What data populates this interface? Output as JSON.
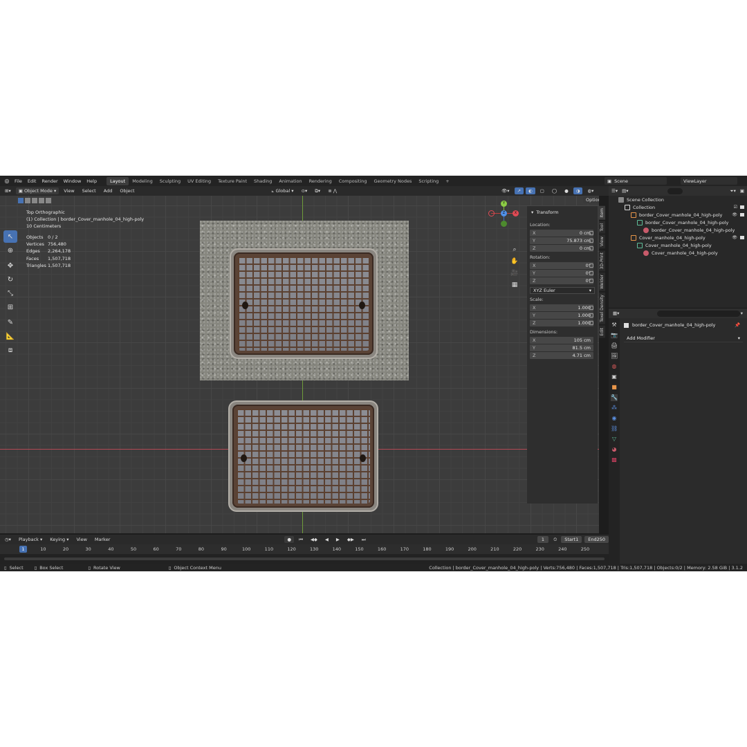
{
  "menu": [
    "File",
    "Edit",
    "Render",
    "Window",
    "Help"
  ],
  "workspaces": [
    "Layout",
    "Modeling",
    "Sculpting",
    "UV Editing",
    "Texture Paint",
    "Shading",
    "Animation",
    "Rendering",
    "Compositing",
    "Geometry Nodes",
    "Scripting",
    "+"
  ],
  "active_workspace": "Layout",
  "scene": "Scene",
  "view_layer": "ViewLayer",
  "header": {
    "mode": "Object Mode",
    "view": "View",
    "select": "Select",
    "add": "Add",
    "object": "Object",
    "orientation": "Global",
    "options": "Options"
  },
  "overlay": {
    "view_name": "Top Orthographic",
    "collection": "(1) Collection | border_Cover_manhole_04_high-poly",
    "scale": "10 Centimeters"
  },
  "stats": [
    {
      "k": "Objects",
      "v": "0 / 2"
    },
    {
      "k": "Vertices",
      "v": "756,480"
    },
    {
      "k": "Edges",
      "v": "2,264,178"
    },
    {
      "k": "Faces",
      "v": "1,507,718"
    },
    {
      "k": "Triangles",
      "v": "1,507,718"
    }
  ],
  "gizmo": {
    "y": "Y",
    "x": "X",
    "z": "Z"
  },
  "transform": {
    "title": "Transform",
    "location_label": "Location:",
    "location": [
      {
        "a": "X",
        "v": "0 cm"
      },
      {
        "a": "Y",
        "v": "75.873 cm"
      },
      {
        "a": "Z",
        "v": "0 cm"
      }
    ],
    "rotation_label": "Rotation:",
    "rotation": [
      {
        "a": "X",
        "v": "0°"
      },
      {
        "a": "Y",
        "v": "0°"
      },
      {
        "a": "Z",
        "v": "0°"
      }
    ],
    "rotation_mode": "XYZ Euler",
    "scale_label": "Scale:",
    "scale": [
      {
        "a": "X",
        "v": "1.000"
      },
      {
        "a": "Y",
        "v": "1.000"
      },
      {
        "a": "Z",
        "v": "1.000"
      }
    ],
    "dimensions_label": "Dimensions:",
    "dimensions": [
      {
        "a": "X",
        "v": "105 cm"
      },
      {
        "a": "Y",
        "v": "81.5 cm"
      },
      {
        "a": "Z",
        "v": "4.71 cm"
      }
    ]
  },
  "side_tabs": [
    "Item",
    "Tool",
    "View",
    "3D-Print",
    "Welder",
    "Texel Density",
    "Edit"
  ],
  "outliner": {
    "scene_collection": "Scene Collection",
    "rows": [
      {
        "label": "Collection",
        "indent": 1,
        "icon": "collection-icon",
        "color": "#dcdcdc"
      },
      {
        "label": "border_Cover_manhole_04_high-poly",
        "indent": 2,
        "icon": "object-icon",
        "color": "#e8964a"
      },
      {
        "label": "border_Cover_manhole_04_high-poly",
        "indent": 3,
        "icon": "mesh-icon",
        "color": "#5fbf9a"
      },
      {
        "label": "border_Cover_manhole_04_high-poly",
        "indent": 4,
        "icon": "material-icon",
        "color": "#c85b6b"
      },
      {
        "label": "Cover_manhole_04_high-poly",
        "indent": 2,
        "icon": "object-icon",
        "color": "#e8964a"
      },
      {
        "label": "Cover_manhole_04_high-poly",
        "indent": 3,
        "icon": "mesh-icon",
        "color": "#5fbf9a"
      },
      {
        "label": "Cover_manhole_04_high-poly",
        "indent": 4,
        "icon": "material-icon",
        "color": "#c85b6b"
      }
    ]
  },
  "properties": {
    "object_name": "border_Cover_manhole_04_high-poly",
    "add_modifier": "Add Modifier"
  },
  "timeline": {
    "playback": "Playback",
    "keying": "Keying",
    "view": "View",
    "marker": "Marker",
    "current_frame": "1",
    "start_label": "Start",
    "start": "1",
    "end_label": "End",
    "end": "250",
    "ticks": [
      "10",
      "20",
      "30",
      "40",
      "50",
      "60",
      "70",
      "80",
      "90",
      "100",
      "110",
      "120",
      "130",
      "140",
      "150",
      "160",
      "170",
      "180",
      "190",
      "200",
      "210",
      "220",
      "230",
      "240",
      "250"
    ]
  },
  "status": {
    "select": "Select",
    "box_select": "Box Select",
    "rotate_view": "Rotate View",
    "context_menu": "Object Context Menu",
    "info": "Collection | border_Cover_manhole_04_high-poly | Verts:756,480 | Faces:1,507,718 | Tris:1,507,718 | Objects:0/2 | Memory: 2.58 GiB | 3.1.2"
  }
}
